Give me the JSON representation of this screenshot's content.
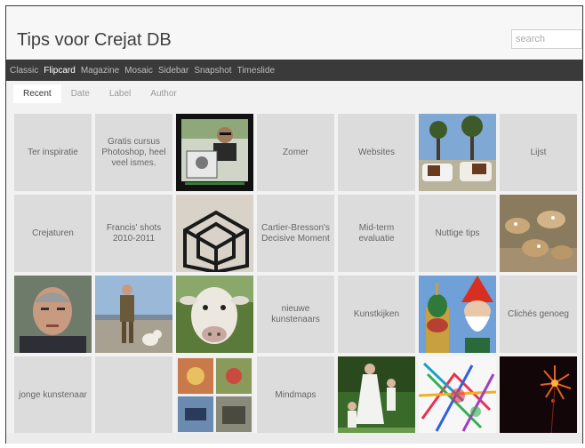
{
  "header": {
    "title": "Tips voor Crejat DB",
    "search_placeholder": "search"
  },
  "nav": [
    "Classic",
    "Flipcard",
    "Magazine",
    "Mosaic",
    "Sidebar",
    "Snapshot",
    "Timeslide"
  ],
  "nav_active": "Flipcard",
  "tabs": [
    "Recent",
    "Date",
    "Label",
    "Author"
  ],
  "tab_active": "Recent",
  "tiles": [
    {
      "label": "Ter inspiratie"
    },
    {
      "label": "Gratis cursus Photoshop, heel veel ismes."
    },
    {
      "image": "photo-man-holding-portrait"
    },
    {
      "label": "Zomer"
    },
    {
      "label": "Websites"
    },
    {
      "image": "photo-cows-under-trees"
    },
    {
      "label": "Lijst"
    },
    {
      "label": "Crejaturen"
    },
    {
      "label": "Francis' shots 2010-2011"
    },
    {
      "image": "photo-wire-cube-sculpture"
    },
    {
      "label": "Cartier-Bresson's Decisive Moment"
    },
    {
      "label": "Mid-term evaluatie"
    },
    {
      "label": "Nuttige tips"
    },
    {
      "image": "photo-deer-herd"
    },
    {
      "image": "photo-old-man-portrait"
    },
    {
      "image": "photo-man-on-beach-with-dog"
    },
    {
      "image": "photo-white-cow-closeup"
    },
    {
      "label": "nieuwe kunstenaars"
    },
    {
      "label": "Kunstkijken"
    },
    {
      "image": "photo-gnome-and-domes"
    },
    {
      "label": "Clichés genoeg"
    },
    {
      "label": "jonge kunstenaar"
    },
    {
      "label": ""
    },
    {
      "image": "photo-collage-grid"
    },
    {
      "label": "Mindmaps"
    },
    {
      "image": "photo-woman-with-children"
    },
    {
      "image": "photo-colorful-abstract"
    },
    {
      "image": "photo-fireworks-night"
    }
  ]
}
